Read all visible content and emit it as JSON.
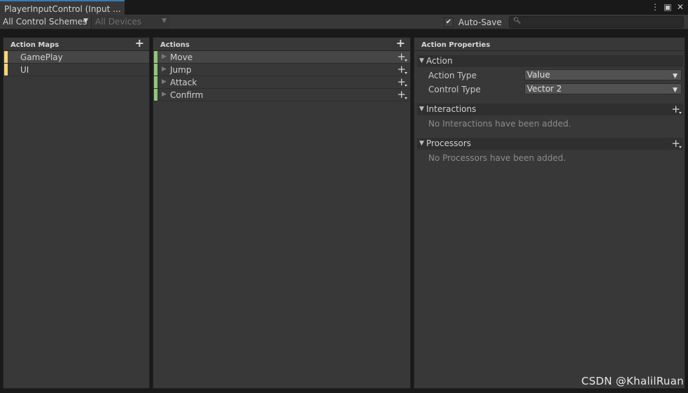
{
  "window": {
    "tab_title": "PlayerInputControl (Input ...",
    "menu_icon": "kebab-menu-icon",
    "maximize_icon": "maximize-icon",
    "close_icon": "close-icon"
  },
  "toolbar": {
    "control_schemes": "All Control Schemes",
    "devices": "All Devices",
    "auto_save_label": "Auto-Save",
    "auto_save_checked": true,
    "search_value": ""
  },
  "action_maps": {
    "header": "Action Maps",
    "items": [
      {
        "label": "GamePlay",
        "selected": true
      },
      {
        "label": "UI",
        "selected": false
      }
    ],
    "marker_color": "#f5d47a"
  },
  "actions": {
    "header": "Actions",
    "items": [
      {
        "label": "Move",
        "selected": true
      },
      {
        "label": "Jump",
        "selected": false
      },
      {
        "label": "Attack",
        "selected": false
      },
      {
        "label": "Confirm",
        "selected": false
      }
    ],
    "marker_color": "#8fc77a"
  },
  "properties": {
    "header": "Action Properties",
    "action_section": "Action",
    "action_type_label": "Action Type",
    "action_type_value": "Value",
    "control_type_label": "Control Type",
    "control_type_value": "Vector 2",
    "interactions_section": "Interactions",
    "interactions_empty": "No Interactions have been added.",
    "processors_section": "Processors",
    "processors_empty": "No Processors have been added."
  },
  "watermark": "CSDN @KhalilRuan"
}
